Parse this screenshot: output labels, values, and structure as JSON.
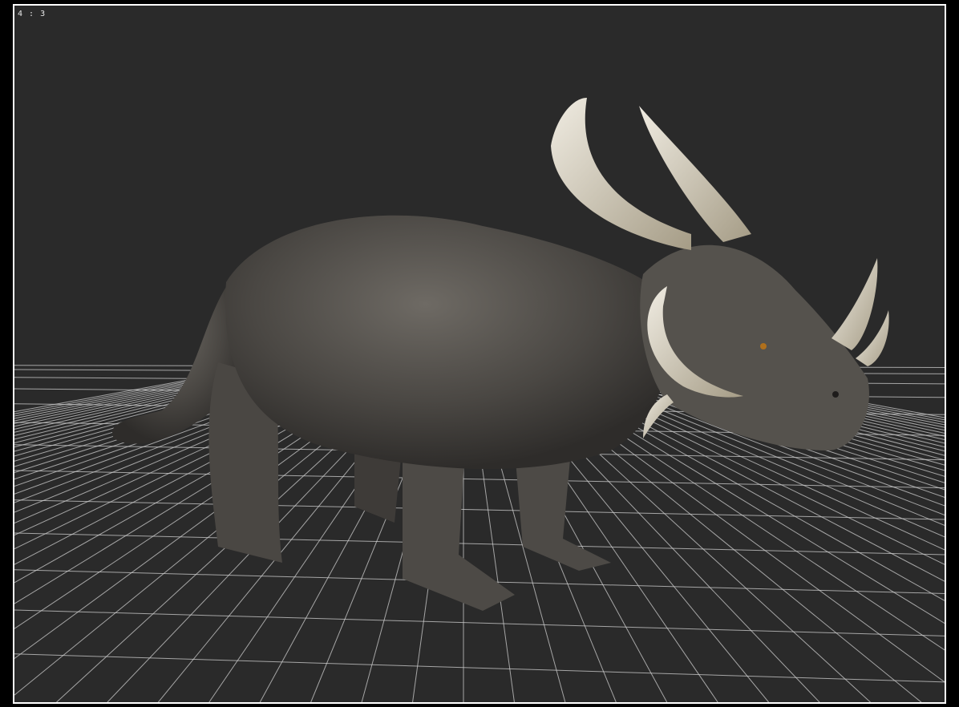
{
  "viewport": {
    "aspect_ratio_label": "4 : 3",
    "background_color": "#2a2a2a",
    "frame_color": "#ffffff",
    "grid_color": "#cfcfcf",
    "model": "horned-dinosaur-figure"
  }
}
